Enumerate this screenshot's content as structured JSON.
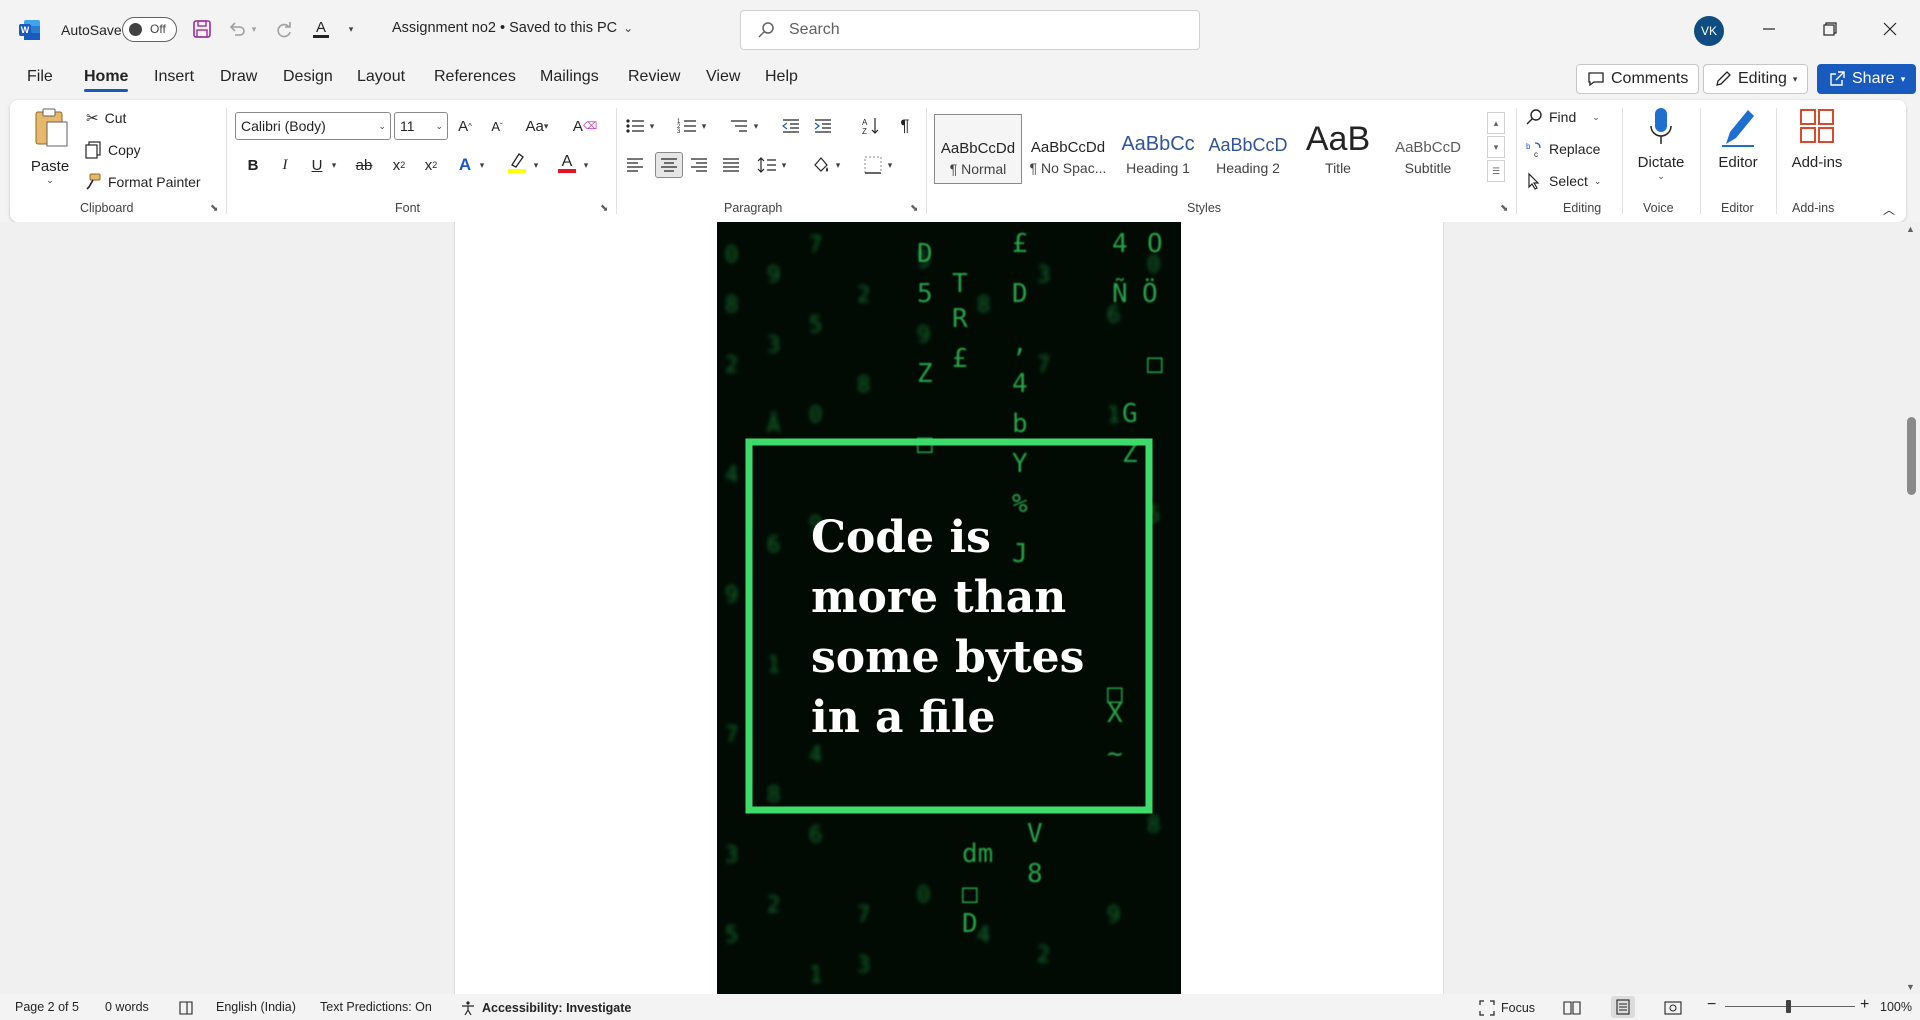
{
  "titlebar": {
    "autosave_label": "AutoSave",
    "autosave_state": "Off",
    "doc_title": "Assignment no2 • Saved to this PC",
    "search_placeholder": "Search",
    "avatar_initials": "VK"
  },
  "tabs": [
    "File",
    "Home",
    "Insert",
    "Draw",
    "Design",
    "Layout",
    "References",
    "Mailings",
    "Review",
    "View",
    "Help"
  ],
  "active_tab": "Home",
  "top_buttons": {
    "comments": "Comments",
    "editing": "Editing",
    "share": "Share"
  },
  "ribbon": {
    "clipboard": {
      "label": "Clipboard",
      "paste": "Paste",
      "cut": "Cut",
      "copy": "Copy",
      "format_painter": "Format Painter"
    },
    "font": {
      "label": "Font",
      "font_name": "Calibri (Body)",
      "font_size": "11",
      "highlight_color": "#ffff00",
      "font_color": "#e81123"
    },
    "paragraph": {
      "label": "Paragraph"
    },
    "styles": {
      "label": "Styles",
      "items": [
        {
          "preview": "AaBbCcDd",
          "name": "¶ Normal"
        },
        {
          "preview": "AaBbCcDd",
          "name": "¶ No Spac..."
        },
        {
          "preview": "AaBbCc",
          "name": "Heading 1"
        },
        {
          "preview": "AaBbCcD",
          "name": "Heading 2"
        },
        {
          "preview": "AaB",
          "name": "Title"
        },
        {
          "preview": "AaBbCcD",
          "name": "Subtitle"
        }
      ]
    },
    "editing": {
      "label": "Editing",
      "find": "Find",
      "replace": "Replace",
      "select": "Select"
    },
    "voice": {
      "label": "Voice",
      "dictate": "Dictate"
    },
    "editor": {
      "label": "Editor",
      "editor": "Editor"
    },
    "addins": {
      "label": "Add-ins",
      "addins": "Add-ins"
    }
  },
  "document": {
    "image_text": [
      "Code is",
      "more than",
      "some bytes",
      "in a file"
    ],
    "frame_color": "#3ddc6a"
  },
  "statusbar": {
    "page": "Page 2 of 5",
    "words": "0 words",
    "language": "English (India)",
    "predictions": "Text Predictions: On",
    "accessibility": "Accessibility: Investigate",
    "focus": "Focus",
    "zoom": "100%"
  }
}
